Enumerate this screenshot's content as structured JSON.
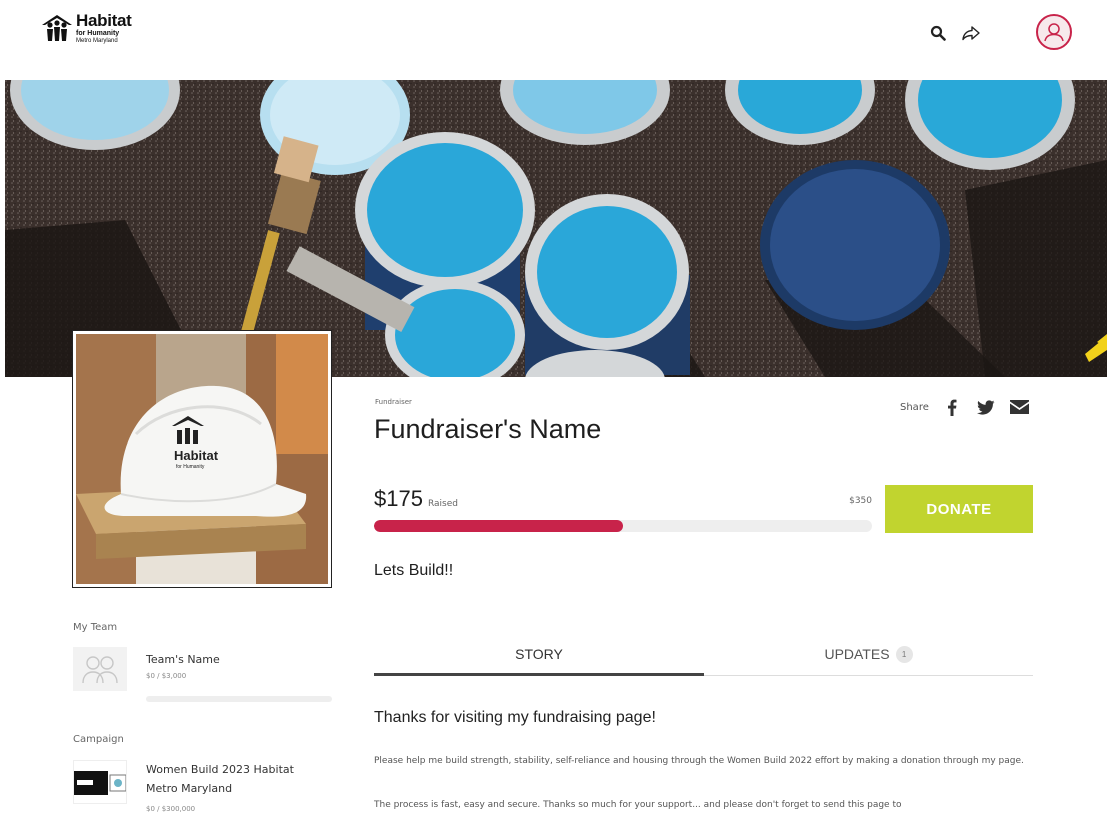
{
  "brand": {
    "name": "Habitat",
    "line2": "for Humanity",
    "line3": "Metro Maryland"
  },
  "header": {
    "icons": [
      "search-icon",
      "share-icon",
      "user-icon"
    ]
  },
  "fundraiser": {
    "label": "Fundraiser",
    "name": "Fundraiser's Name",
    "raised": "$175",
    "raised_label": "Raised",
    "goal": "$350",
    "progress_fraction": 0.5,
    "donate_label": "DONATE",
    "tagline": "Lets Build!!"
  },
  "share": {
    "label": "Share",
    "icons": [
      "facebook-icon",
      "twitter-icon",
      "email-icon"
    ]
  },
  "tabs": [
    {
      "label": "STORY",
      "active": true
    },
    {
      "label": "UPDATES",
      "badge": "1",
      "active": false
    }
  ],
  "story": {
    "title": "Thanks for visiting my fundraising page!",
    "p1": "Please help me build strength, stability, self-reliance and housing through the Women Build 2022 effort by making a donation through my page.",
    "p2": "The process is fast, easy and secure. Thanks so much for your support... and please don't forget to send this page to"
  },
  "sidebar": {
    "team_label": "My Team",
    "team": {
      "name": "Team's Name",
      "amount": "$0 / $3,000",
      "progress_fraction": 0
    },
    "campaign_label": "Campaign",
    "campaign": {
      "name": "Women Build 2023 Habitat Metro Maryland",
      "amount": "$0 / $300,000"
    }
  },
  "colors": {
    "accent": "#c8234a",
    "donate": "#c1d42f",
    "paint": "#29a8d8"
  }
}
